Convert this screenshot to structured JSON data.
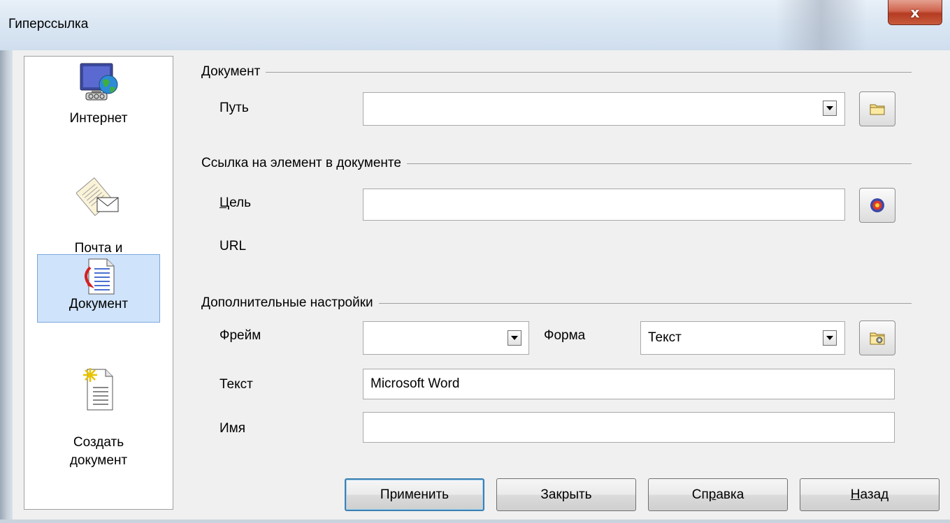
{
  "window": {
    "title": "Гиперссылка",
    "close_glyph": "x"
  },
  "sidebar": {
    "items": [
      {
        "label": "Интернет",
        "icon": "internet-icon"
      },
      {
        "label": "Почта и\nновости",
        "icon": "mail-news-icon"
      },
      {
        "label": "Документ",
        "icon": "document-icon",
        "selected": true
      },
      {
        "label": "Создать\nдокумент",
        "icon": "new-document-icon"
      }
    ]
  },
  "document": {
    "section_title": "Документ",
    "path_label": "Путь",
    "path_value": ""
  },
  "target": {
    "section_title": "Ссылка на элемент в документе",
    "target_label_accel": "Ц",
    "target_label_rest": "ель",
    "target_value": "",
    "url_label": "URL"
  },
  "advanced": {
    "section_title": "Дополнительные настройки",
    "frame_label": "Фрейм",
    "frame_value": "",
    "form_label": "Форма",
    "form_value": "Текст",
    "text_label": "Текст",
    "text_value": "Microsoft Word",
    "name_label": "Имя",
    "name_value": ""
  },
  "buttons": {
    "apply": "Применить",
    "close": "Закрыть",
    "help_pre": "Сп",
    "help_accel": "р",
    "help_post": "авка",
    "back_accel": "Н",
    "back_rest": "азад"
  }
}
